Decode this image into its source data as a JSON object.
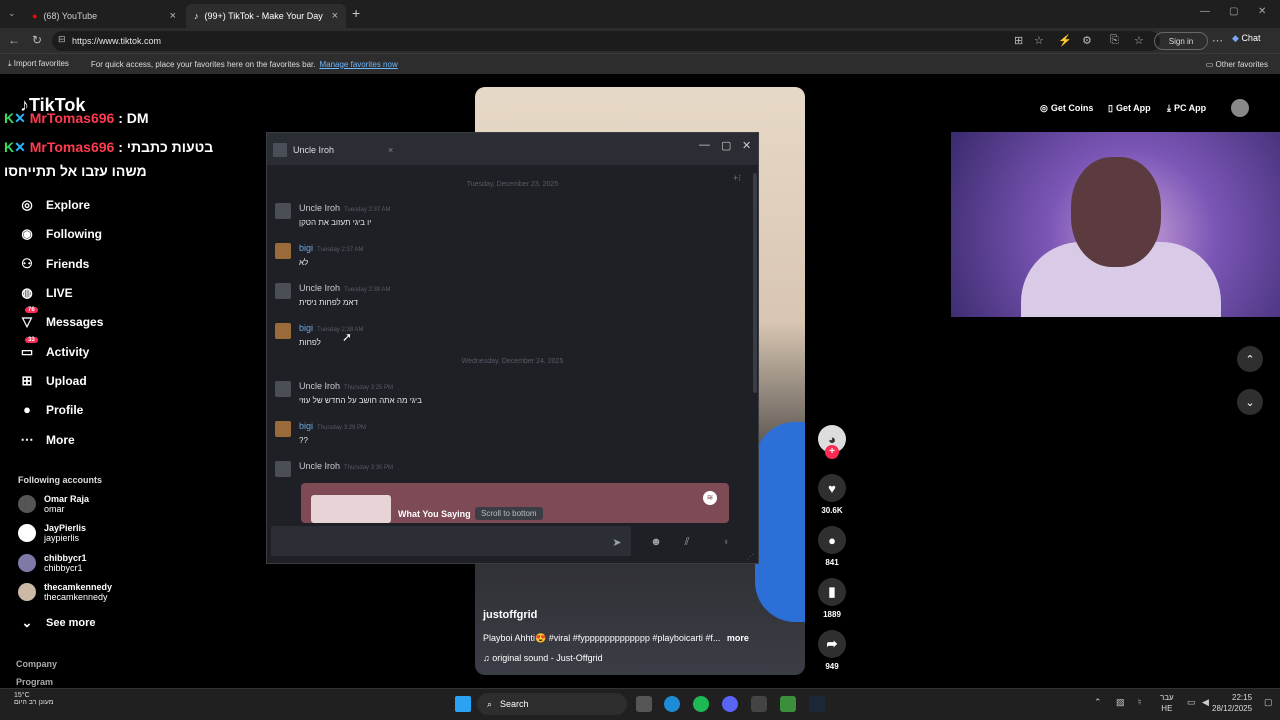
{
  "browser": {
    "tabs": [
      {
        "label": "(68) YouTube"
      },
      {
        "label": "(99+) TikTok - Make Your Day"
      }
    ],
    "url": "https://www.tiktok.com",
    "signin_label": "Sign in",
    "chat_label": "Chat",
    "favorites": {
      "import_label": "Import favorites",
      "hint_text": "For quick access, place your favorites here on the favorites bar.",
      "manage_link": "Manage favorites now",
      "other_label": "Other favorites"
    }
  },
  "overlay": {
    "line1_name": "MrTomas696",
    "line1_text": ": DM",
    "line2_name": "MrTomas696",
    "line2_text": ": בטעות כתבתי",
    "line3_text": "משהו עזבו אל תתייחסו"
  },
  "tiktok": {
    "logo": "TikTok",
    "nav": [
      {
        "label": "Explore",
        "icon": "compass-icon"
      },
      {
        "label": "Following",
        "icon": "following-icon"
      },
      {
        "label": "Friends",
        "icon": "friends-icon"
      },
      {
        "label": "LIVE",
        "icon": "live-icon"
      },
      {
        "label": "Messages",
        "icon": "messages-icon",
        "badge": "76"
      },
      {
        "label": "Activity",
        "icon": "activity-icon",
        "badge": "33"
      },
      {
        "label": "Upload",
        "icon": "upload-icon"
      },
      {
        "label": "Profile",
        "icon": "profile-icon"
      },
      {
        "label": "More",
        "icon": "more-icon"
      }
    ],
    "following_title": "Following accounts",
    "accounts": [
      {
        "name": "Omar Raja",
        "handle": "omar"
      },
      {
        "name": "JayPierlis",
        "handle": "jaypierlis"
      },
      {
        "name": "chibbycr1",
        "handle": "chibbycr1"
      },
      {
        "name": "thecamkennedy",
        "handle": "thecamkennedy"
      }
    ],
    "see_more": "See more",
    "footer": [
      "Company",
      "Program"
    ],
    "top_buttons": {
      "coins": "Get Coins",
      "app": "Get App",
      "pc": "PC App"
    },
    "video": {
      "user": "justoffgrid",
      "desc": "Playboi Ahhti😍 #viral #fyppppppppppppp #playboicarti #f...",
      "more": "more",
      "sound": "original sound - Just-Offgrid"
    },
    "actions": {
      "likes": "30.6K",
      "comments": "841",
      "saves": "1889",
      "shares": "949"
    }
  },
  "chat": {
    "tab_title": "Uncle Iroh",
    "day1": "Tuesday, December 23, 2025",
    "day2": "Wednesday, December 24, 2025",
    "messages": [
      {
        "author": "Uncle Iroh",
        "time": "Tuesday 2:37 AM",
        "text": "יו ביגי תעזוב את הטקן"
      },
      {
        "author": "bigi",
        "time": "Tuesday 2:37 AM",
        "text": "לא"
      },
      {
        "author": "Uncle Iroh",
        "time": "Tuesday 2:38 AM",
        "text": "דאמ לפחות ניסית"
      },
      {
        "author": "bigi",
        "time": "Tuesday 2:38 AM",
        "text": "לפחות"
      },
      {
        "author": "Uncle Iroh",
        "time": "Thursday 3:25 PM",
        "text": "ביגי מה אתה חושב על החדש של עוזי"
      },
      {
        "author": "bigi",
        "time": "Thursday 3:29 PM",
        "text": "??"
      },
      {
        "author": "Uncle Iroh",
        "time": "Thursday 3:30 PM",
        "text": ""
      }
    ],
    "embed_title": "What You Saying",
    "scroll_bottom": "Scroll to bottom"
  },
  "taskbar": {
    "weather_temp": "15°C",
    "weather_desc": "מעונן רב היום",
    "search": "Search",
    "lang_top": "עבר",
    "lang_bottom": "HE",
    "time": "22:15",
    "date": "28/12/2025"
  }
}
